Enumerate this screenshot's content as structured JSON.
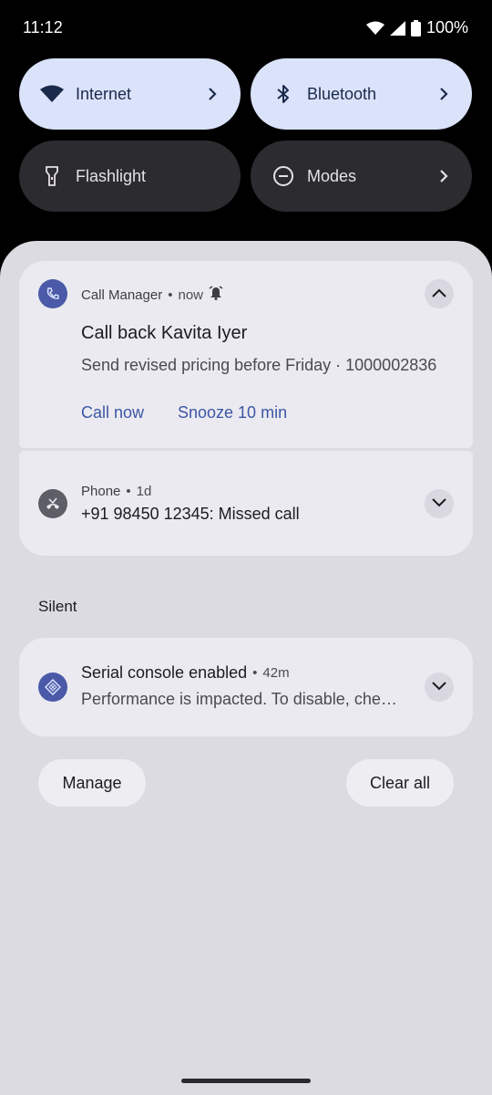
{
  "status_bar": {
    "time": "11:12",
    "battery": "100%"
  },
  "quick_tiles": [
    {
      "label": "Internet",
      "icon": "wifi-icon",
      "state": "on"
    },
    {
      "label": "Bluetooth",
      "icon": "bluetooth-icon",
      "state": "on"
    },
    {
      "label": "Flashlight",
      "icon": "flashlight-icon",
      "state": "off"
    },
    {
      "label": "Modes",
      "icon": "modes-icon",
      "state": "off"
    }
  ],
  "notifications": [
    {
      "app": "Call Manager",
      "time": "now",
      "title": "Call back Kavita Iyer",
      "text": "Send revised pricing before Friday · 1000002836",
      "actions": [
        "Call now",
        "Snooze 10 min"
      ]
    },
    {
      "app": "Phone",
      "time": "1d",
      "text": "+91 98450 12345: Missed call"
    }
  ],
  "silent_section": {
    "label": "Silent",
    "notification": {
      "title": "Serial console enabled",
      "time": "42m",
      "text": "Performance is impacted. To disable, che…"
    }
  },
  "footer": {
    "manage": "Manage",
    "clear_all": "Clear all"
  },
  "colors": {
    "tile_on": "#dbe3fb",
    "tile_off": "#2b2b30",
    "accent": "#3c56a6",
    "shade": "#dcdbe2"
  }
}
